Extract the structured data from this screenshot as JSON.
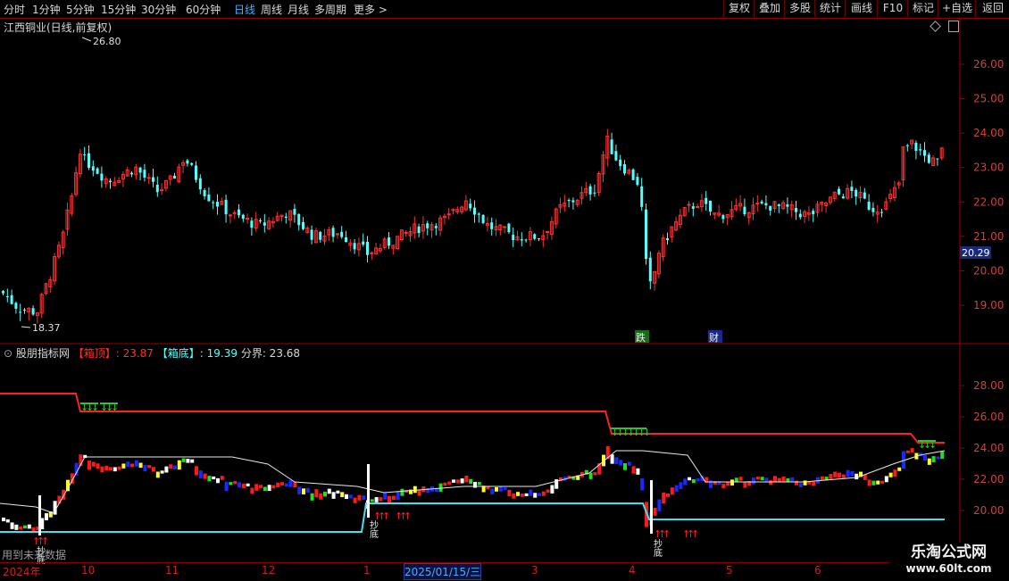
{
  "toolbar": {
    "periods": [
      "分时",
      "1分钟",
      "5分钟",
      "15分钟",
      "30分钟",
      "60分钟",
      "日线",
      "周线",
      "月线",
      "多周期",
      "更多 >"
    ],
    "active_period": "日线",
    "right_buttons": [
      "复权",
      "叠加",
      "多股",
      "统计",
      "画线",
      "F10",
      "标记",
      "+自选",
      "返回"
    ]
  },
  "stock": {
    "title": "江西铜业(日线,前复权)",
    "high_label": "26.80",
    "low_label": "18.37",
    "current_price": "20.29",
    "price_ticks": [
      "26.00",
      "25.00",
      "24.00",
      "23.00",
      "22.00",
      "21.00",
      "20.00",
      "19.00"
    ],
    "markers": [
      "跌",
      "财"
    ]
  },
  "indicator": {
    "name": "股朋指标网",
    "top_label": "【箱顶】: 23.87",
    "bottom_label": "【箱底】: 19.39",
    "split_label": "分界: 23.68",
    "ticks": [
      "28.00",
      "26.00",
      "24.00",
      "22.00",
      "20.00"
    ],
    "buy_text": "抄底",
    "footer": "用到未来数据"
  },
  "date_axis": {
    "labels": [
      "2024年",
      "10",
      "11",
      "12",
      "1",
      "2025/01/15/三",
      "3",
      "4",
      "5",
      "6"
    ]
  },
  "watermark": {
    "title": "乐淘公式网",
    "url": "www.60lt.com"
  },
  "colors": {
    "up": "#ff3030",
    "down": "#54ffff",
    "box_top": "#ff2020",
    "box_bottom": "#40e0f0",
    "split": "#e8e8e8",
    "sell_marker": "#20d020",
    "buy_marker": "#ff2020",
    "axis_line": "#9a0000"
  }
}
